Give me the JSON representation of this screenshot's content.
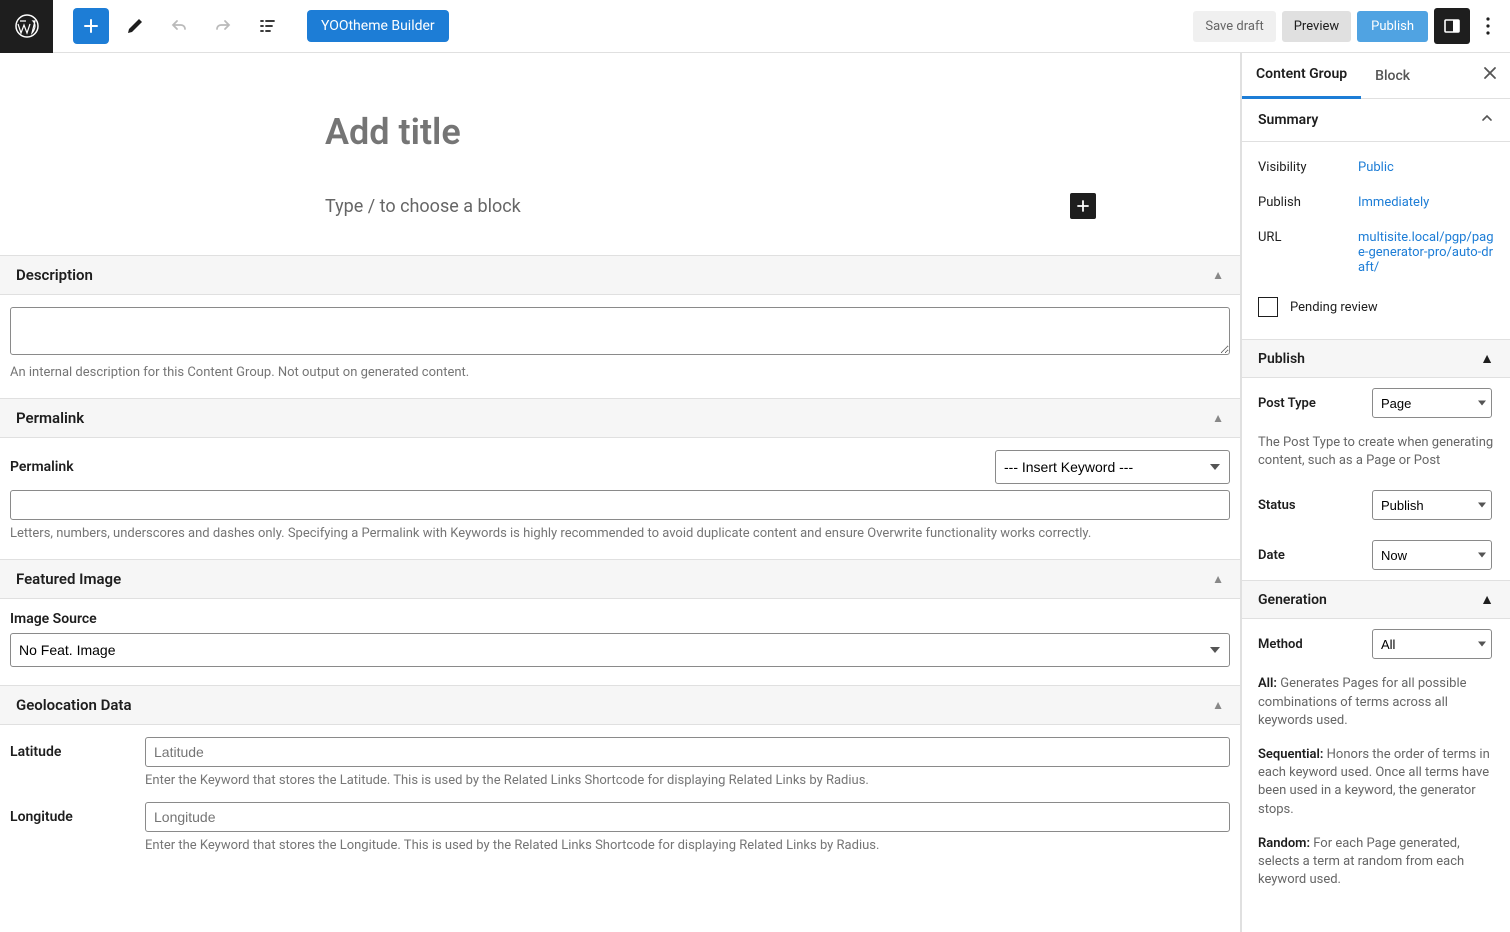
{
  "topbar": {
    "builder_label": "YOOtheme Builder",
    "save_draft": "Save draft",
    "preview": "Preview",
    "publish": "Publish"
  },
  "editor": {
    "title_placeholder": "Add title",
    "block_placeholder": "Type / to choose a block"
  },
  "sections": {
    "description": {
      "title": "Description",
      "help": "An internal description for this Content Group. Not output on generated content."
    },
    "permalink": {
      "title": "Permalink",
      "field_label": "Permalink",
      "keyword_select": "--- Insert Keyword ---",
      "help": "Letters, numbers, underscores and dashes only. Specifying a Permalink with Keywords is highly recommended to avoid duplicate content and ensure Overwrite functionality works correctly."
    },
    "featured": {
      "title": "Featured Image",
      "source_label": "Image Source",
      "source_value": "No Feat. Image"
    },
    "geo": {
      "title": "Geolocation Data",
      "lat_label": "Latitude",
      "lat_placeholder": "Latitude",
      "lat_help": "Enter the Keyword that stores the Latitude. This is used by the Related Links Shortcode for displaying Related Links by Radius.",
      "lon_label": "Longitude",
      "lon_placeholder": "Longitude",
      "lon_help": "Enter the Keyword that stores the Longitude. This is used by the Related Links Shortcode for displaying Related Links by Radius."
    }
  },
  "sidebar": {
    "tabs": {
      "content_group": "Content Group",
      "block": "Block"
    },
    "summary": {
      "title": "Summary",
      "visibility_label": "Visibility",
      "visibility_value": "Public",
      "publish_label": "Publish",
      "publish_value": "Immediately",
      "url_label": "URL",
      "url_value": "multisite.local/pgp/page-generator-pro/auto-draft/",
      "pending": "Pending review"
    },
    "publish": {
      "title": "Publish",
      "post_type_label": "Post Type",
      "post_type_value": "Page",
      "post_type_help": "The Post Type to create when generating content, such as a Page or Post",
      "status_label": "Status",
      "status_value": "Publish",
      "date_label": "Date",
      "date_value": "Now"
    },
    "generation": {
      "title": "Generation",
      "method_label": "Method",
      "method_value": "All",
      "help_all_lead": "All:",
      "help_all": " Generates Pages for all possible combinations of terms across all keywords used.",
      "help_seq_lead": "Sequential:",
      "help_seq": " Honors the order of terms in each keyword used. Once all terms have been used in a keyword, the generator stops.",
      "help_rand_lead": "Random:",
      "help_rand": " For each Page generated, selects a term at random from each keyword used."
    }
  }
}
